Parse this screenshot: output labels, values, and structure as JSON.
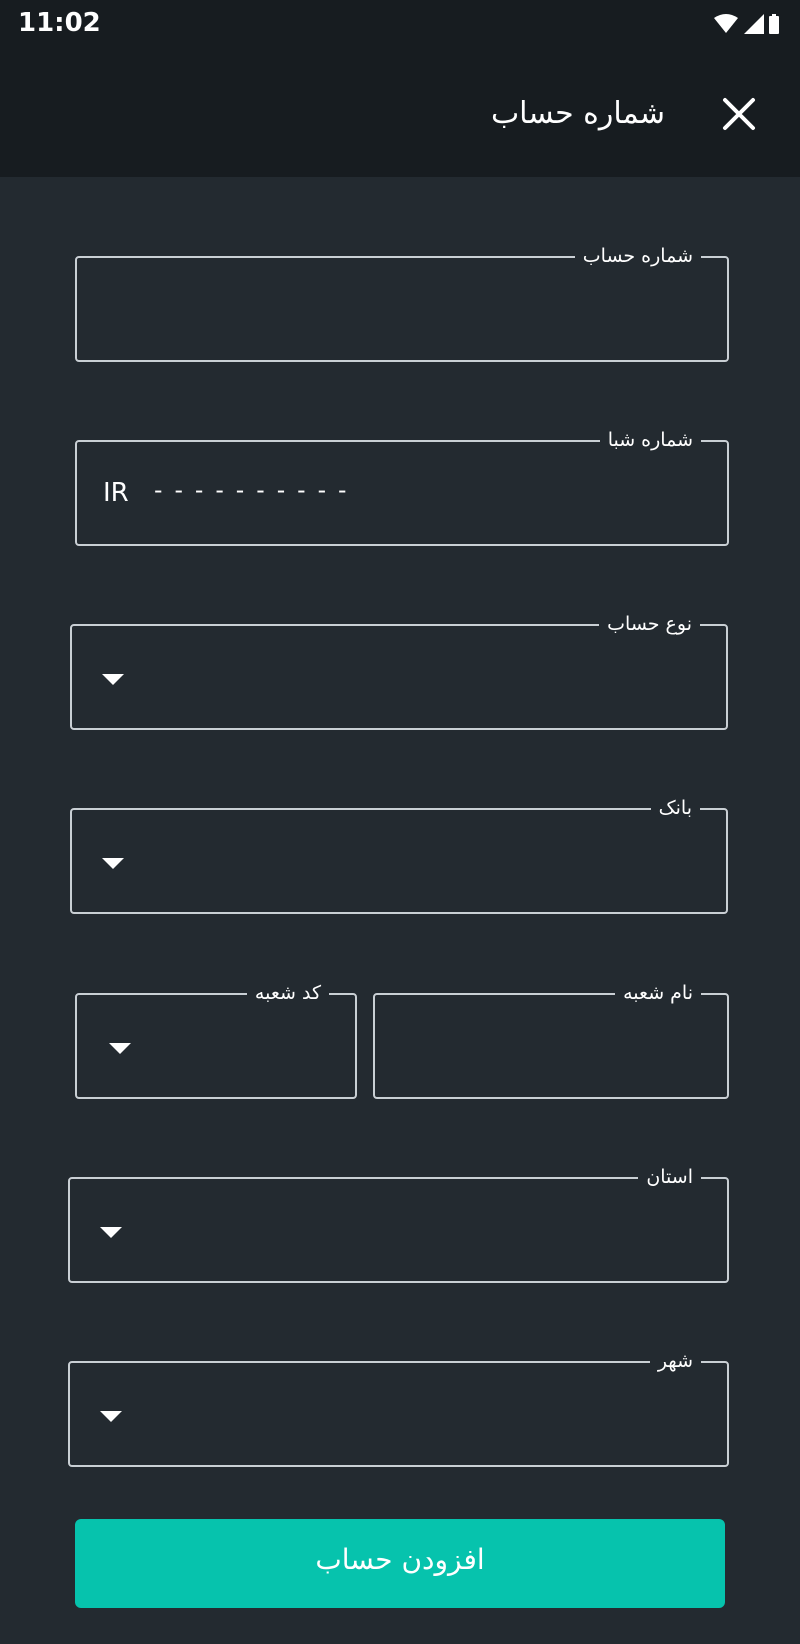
{
  "status_bar": {
    "time": "11:02",
    "icons": [
      "wifi-icon",
      "cellular-signal-icon",
      "battery-icon"
    ]
  },
  "app_bar": {
    "title": "شماره حساب",
    "close_icon": "close-icon"
  },
  "form": {
    "account_number": {
      "label": "شماره حساب",
      "value": ""
    },
    "sheba": {
      "label": "شماره شبا",
      "prefix": "IR",
      "mask": "----------"
    },
    "account_type": {
      "label": "نوع حساب",
      "value": ""
    },
    "bank": {
      "label": "بانک",
      "value": ""
    },
    "branch_name": {
      "label": "نام شعبه",
      "value": ""
    },
    "branch_code": {
      "label": "کد شعبه",
      "value": ""
    },
    "province": {
      "label": "استان",
      "value": ""
    },
    "city": {
      "label": "شهر",
      "value": ""
    }
  },
  "submit_button": {
    "label": "افزودن حساب"
  },
  "colors": {
    "background": "#232a30",
    "bar_background": "#171c20",
    "accent": "#06c3ad",
    "field_border": "#c9cfd4"
  }
}
